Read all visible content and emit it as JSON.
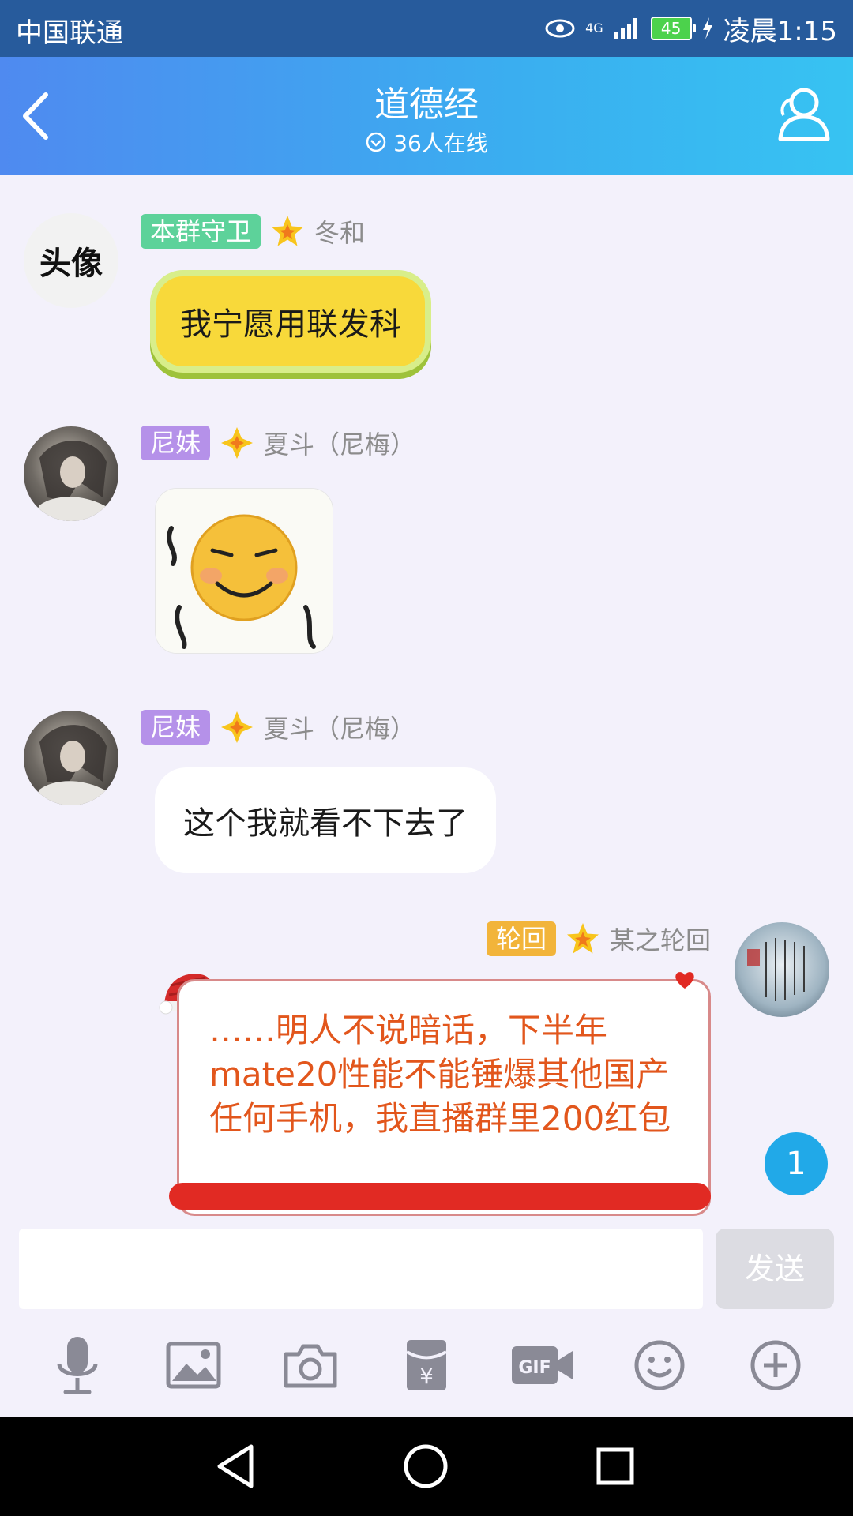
{
  "status_bar": {
    "carrier": "中国联通",
    "network": "4G",
    "battery": "45",
    "time": "凌晨1:15"
  },
  "header": {
    "title": "道德经",
    "online_count": "36人在线"
  },
  "messages": [
    {
      "tag": "本群守卫",
      "sender": "冬和",
      "text": "我宁愿用联发科",
      "avatar_text": "头像"
    },
    {
      "tag": "尼妹",
      "sender": "夏斗（尼梅）",
      "type": "sticker"
    },
    {
      "tag": "尼妹",
      "sender": "夏斗（尼梅）",
      "text": "这个我就看不下去了"
    },
    {
      "tag": "轮回",
      "sender": "某之轮回",
      "text": "……明人不说暗话，下半年mate20性能不能锤爆其他国产任何手机，我直播群里200红包"
    }
  ],
  "unread_badge": "1",
  "input": {
    "value": "",
    "send_label": "发送"
  },
  "colors": {
    "status_bar_bg": "#275b9c",
    "header_gradient_start": "#4f8af0",
    "header_gradient_end": "#37c3f2",
    "tag_green": "#5dd29a",
    "tag_purple": "#b591e9",
    "tag_orange": "#f2b43a",
    "card_text": "#e2561c"
  }
}
